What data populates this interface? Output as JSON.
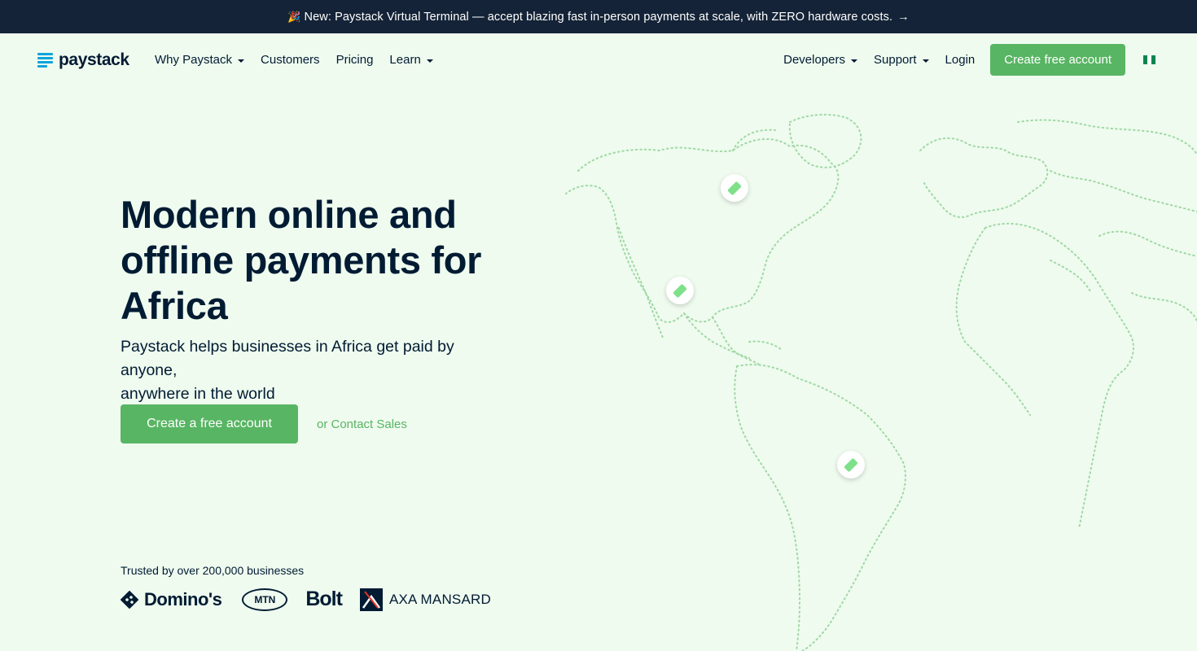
{
  "announcement": {
    "emoji": "🎉",
    "text": "New: Paystack Virtual Terminal — accept blazing fast in-person payments at scale, with ZERO hardware costs.",
    "arrow": "→"
  },
  "nav": {
    "logo_text": "paystack",
    "left_items": [
      "Why Paystack",
      "Customers",
      "Pricing",
      "Learn"
    ],
    "developers": "Developers",
    "support": "Support",
    "login": "Login",
    "cta": "Create free account"
  },
  "hero": {
    "title_line1": "Modern online and",
    "title_line2": "offline payments for",
    "title_line3": "Africa",
    "subtitle_line1": "Paystack helps businesses in Africa get paid by anyone,",
    "subtitle_line2": "anywhere in the world",
    "cta": "Create a free account",
    "secondary_link": "or Contact Sales"
  },
  "trusted": {
    "text": "Trusted by over 200,000 businesses",
    "logos": [
      "Domino's",
      "MTN",
      "Bolt",
      "AXA MANSARD"
    ]
  },
  "colors": {
    "accent": "#58b563",
    "navy": "#011b33",
    "banner": "#142337",
    "background": "#effbef",
    "flag_green": "#008751",
    "flag_white": "#ffffff",
    "map_dots": "#9fd8a4"
  },
  "icons": [
    "party-popper-icon",
    "arrow-right-icon",
    "caret-down-icon",
    "nigeria-flag-icon",
    "card-pin-icon"
  ]
}
